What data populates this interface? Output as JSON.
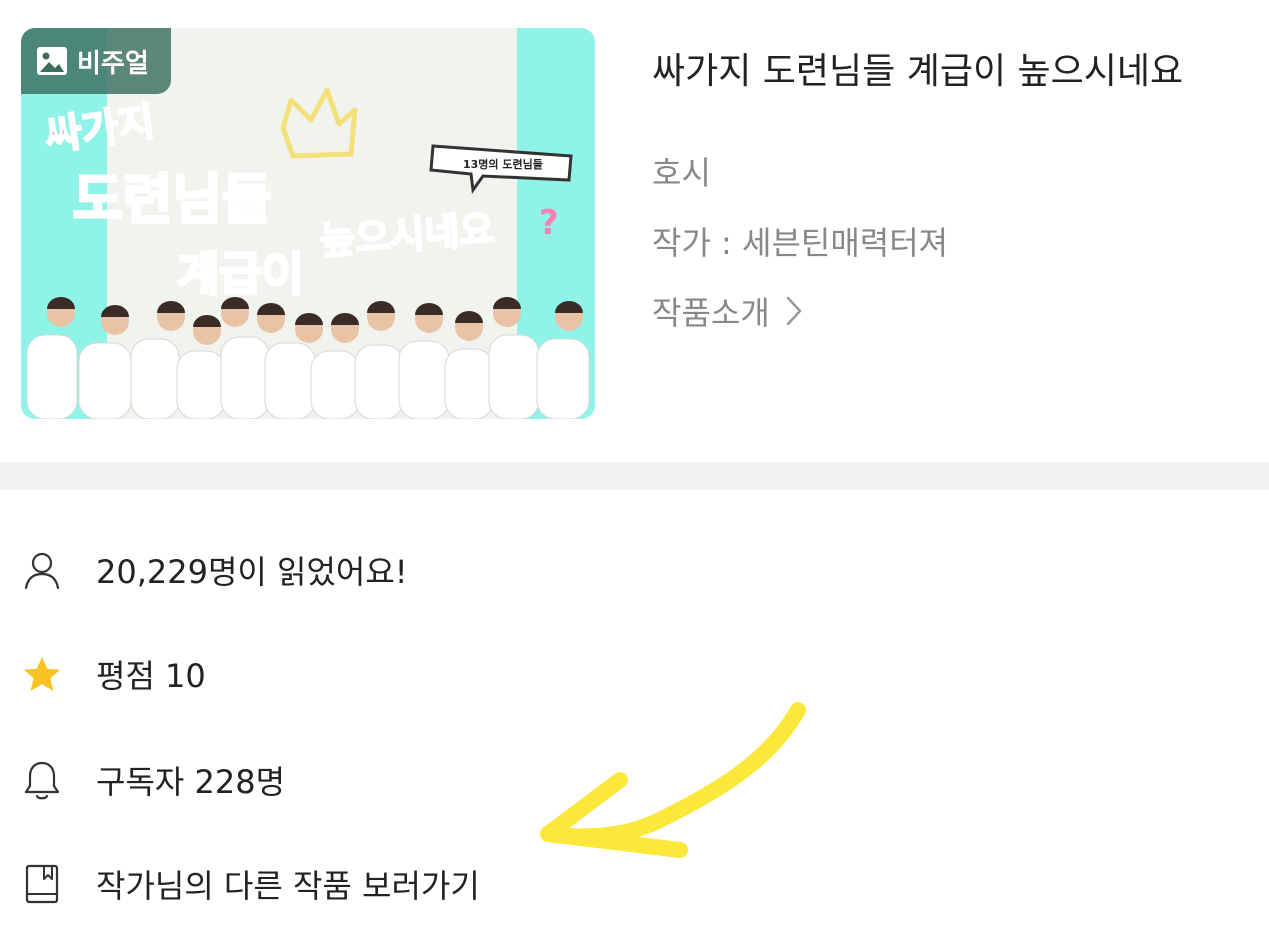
{
  "cover": {
    "badge_label": "비주얼",
    "art_title_line1": "싸가지",
    "art_title_line2": "도련님들",
    "art_title_line3": "계급이",
    "art_title_line4": "높으시네요",
    "art_bubble": "13명의 도련님들",
    "colors": {
      "band": "#8ff3e8",
      "title_fill": "#ff7fb3",
      "crown": "#f4e07a"
    }
  },
  "work": {
    "title": "싸가지 도련님들 계급이 높으시네요",
    "genre": "호시",
    "author": "작가 : 세븐틴매력터져",
    "intro_label": "작품소개"
  },
  "stats": {
    "readers": "20,229명이 읽었어요!",
    "rating": "평점 10",
    "subscribers": "구독자 228명",
    "other_works": "작가님의 다른 작품 보러가기"
  },
  "icons": {
    "readers": "person-icon",
    "rating": "star-icon",
    "subscribers": "bell-icon",
    "other_works": "book-icon",
    "intro": "chevron-right-icon",
    "badge": "image-icon"
  },
  "colors": {
    "star": "#f8c325",
    "annotation_arrow": "#fbe83a",
    "divider": "#f1f2f4",
    "muted_text": "#888888"
  }
}
